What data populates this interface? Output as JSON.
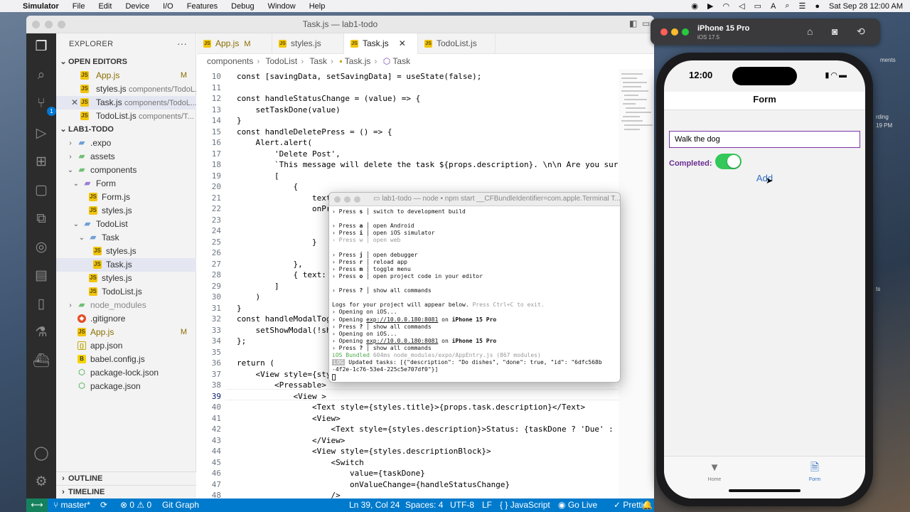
{
  "menubar": {
    "app": "Simulator",
    "items": [
      "File",
      "Edit",
      "Device",
      "I/O",
      "Features",
      "Debug",
      "Window",
      "Help"
    ],
    "datetime": "Sat Sep 28  12:00 AM"
  },
  "vscode": {
    "window_title": "Task.js — lab1-todo",
    "explorer_title": "EXPLORER",
    "open_editors_title": "OPEN EDITORS",
    "open_editors": [
      {
        "name": "App.js",
        "path": "",
        "mark": "M"
      },
      {
        "name": "styles.js",
        "path": "components/TodoL...",
        "mark": ""
      },
      {
        "name": "Task.js",
        "path": "components/TodoL...",
        "mark": ""
      },
      {
        "name": "TodoList.js",
        "path": "components/T...",
        "mark": ""
      }
    ],
    "project_title": "LAB1-TODO",
    "tree": [
      {
        "name": ".expo",
        "mark": ""
      },
      {
        "name": "assets",
        "mark": ""
      },
      {
        "name": "components",
        "mark": ""
      },
      {
        "name": "Form",
        "mark": ""
      },
      {
        "name": "Form.js",
        "mark": ""
      },
      {
        "name": "styles.js",
        "mark": ""
      },
      {
        "name": "TodoList",
        "mark": ""
      },
      {
        "name": "Task",
        "mark": ""
      },
      {
        "name": "styles.js",
        "mark": ""
      },
      {
        "name": "Task.js",
        "mark": ""
      },
      {
        "name": "styles.js",
        "mark": ""
      },
      {
        "name": "TodoList.js",
        "mark": ""
      },
      {
        "name": "node_modules",
        "mark": ""
      },
      {
        "name": ".gitignore",
        "mark": ""
      },
      {
        "name": "App.js",
        "mark": "M"
      },
      {
        "name": "app.json",
        "mark": ""
      },
      {
        "name": "babel.config.js",
        "mark": ""
      },
      {
        "name": "package-lock.json",
        "mark": ""
      },
      {
        "name": "package.json",
        "mark": ""
      }
    ],
    "outline_title": "OUTLINE",
    "timeline_title": "TIMELINE",
    "tabs": [
      {
        "label": "App.js",
        "mark": "M"
      },
      {
        "label": "styles.js",
        "mark": ""
      },
      {
        "label": "Task.js",
        "mark": "",
        "close": "✕"
      },
      {
        "label": "TodoList.js",
        "mark": ""
      }
    ],
    "breadcrumb": [
      "components",
      "TodoList",
      "Task",
      "Task.js",
      "Task"
    ],
    "code_lines": [
      {
        "n": "10",
        "t": "const [savingData, setSavingData] = useState(false);"
      },
      {
        "n": "11",
        "t": ""
      },
      {
        "n": "12",
        "t": "const handleStatusChange = (value) => {"
      },
      {
        "n": "13",
        "t": "    setTaskDone(value)"
      },
      {
        "n": "14",
        "t": "}"
      },
      {
        "n": "15",
        "t": "const handleDeletePress = () => {"
      },
      {
        "n": "16",
        "t": "    Alert.alert("
      },
      {
        "n": "17",
        "t": "        'Delete Post',"
      },
      {
        "n": "18",
        "t": "        `This message will delete the task ${props.description}. \\n\\n Are you sure?`,"
      },
      {
        "n": "19",
        "t": "        ["
      },
      {
        "n": "20",
        "t": "            {"
      },
      {
        "n": "21",
        "t": "                text:"
      },
      {
        "n": "22",
        "t": "                onPre"
      },
      {
        "n": "23",
        "t": "                    c"
      },
      {
        "n": "24",
        "t": "                    h"
      },
      {
        "n": "25",
        "t": "                }"
      },
      {
        "n": "26",
        "t": ""
      },
      {
        "n": "27",
        "t": "            },"
      },
      {
        "n": "28",
        "t": "            { text: '"
      },
      {
        "n": "29",
        "t": "        ]"
      },
      {
        "n": "30",
        "t": "    )"
      },
      {
        "n": "31",
        "t": "}"
      },
      {
        "n": "32",
        "t": "const handleModalTogg"
      },
      {
        "n": "33",
        "t": "    setShowModal(!sho"
      },
      {
        "n": "34",
        "t": "};"
      },
      {
        "n": "35",
        "t": ""
      },
      {
        "n": "36",
        "t": "return ("
      },
      {
        "n": "37",
        "t": "    <View style={styl"
      },
      {
        "n": "38",
        "t": "        <Pressable>"
      },
      {
        "n": "39",
        "t": "            <View >"
      },
      {
        "n": "40",
        "t": "                <Text style={styles.title}>{props.task.description}</Text>"
      },
      {
        "n": "41",
        "t": "                <View>"
      },
      {
        "n": "42",
        "t": "                    <Text style={styles.description}>Status: {taskDone ? 'Due' : 'Done'}"
      },
      {
        "n": "43",
        "t": "                </View>"
      },
      {
        "n": "44",
        "t": "                <View style={styles.descriptionBlock}>"
      },
      {
        "n": "45",
        "t": "                    <Switch"
      },
      {
        "n": "46",
        "t": "                        value={taskDone}"
      },
      {
        "n": "47",
        "t": "                        onValueChange={handleStatusChange}"
      },
      {
        "n": "48",
        "t": "                    />"
      }
    ],
    "status": {
      "branch": "master*",
      "sync": "⟳",
      "problems": "⊗ 0 ⚠ 0",
      "git_graph": "Git Graph",
      "position": "Ln 39, Col 24",
      "spaces": "Spaces: 4",
      "encoding": "UTF-8",
      "eol": "LF",
      "language": "JavaScript",
      "golive": "Go Live",
      "prettier": "Prettier"
    }
  },
  "terminal": {
    "title": "lab1-todo — node • npm start __CFBundleIdentifier=com.apple.Terminal T...",
    "lines": [
      {
        "type": "cmd",
        "key": "s",
        "text": "switch to development build"
      },
      {
        "type": "blank"
      },
      {
        "type": "cmd",
        "key": "a",
        "text": "open Android"
      },
      {
        "type": "cmd",
        "key": "i",
        "text": "open iOS simulator"
      },
      {
        "type": "dimcmd",
        "key": "w",
        "text": "open web"
      },
      {
        "type": "blank"
      },
      {
        "type": "cmd",
        "key": "j",
        "text": "open debugger"
      },
      {
        "type": "cmd",
        "key": "r",
        "text": "reload app"
      },
      {
        "type": "cmd",
        "key": "m",
        "text": "toggle menu"
      },
      {
        "type": "cmd",
        "key": "o",
        "text": "open project code in your editor"
      },
      {
        "type": "blank"
      },
      {
        "type": "cmd",
        "key": "?",
        "text": "show all commands"
      },
      {
        "type": "blank"
      },
      {
        "type": "plain",
        "text": "Logs for your project will appear below.",
        "dim": "Press Ctrl+C to exit."
      },
      {
        "type": "plain",
        "text": "› Opening on iOS..."
      },
      {
        "type": "open",
        "url": "exp://10.0.0.180:8081",
        "dev": "iPhone 15 Pro"
      },
      {
        "type": "cmd",
        "key": "?",
        "text": "show all commands"
      },
      {
        "type": "plain",
        "text": "› Opening on iOS..."
      },
      {
        "type": "open",
        "url": "exp://10.0.0.180:8081",
        "dev": "iPhone 15 Pro"
      },
      {
        "type": "cmd",
        "key": "?",
        "text": "show all commands"
      },
      {
        "type": "bundle",
        "text": "iOS Bundled",
        "rest": "604ms node_modules/expo/AppEntry.js (867 modules)"
      },
      {
        "type": "log",
        "tag": "LOG",
        "text": "Updated tasks: [{\"description\": \"Do dishes\", \"done\": true, \"id\": \"6dfc568b"
      },
      {
        "type": "plain",
        "text": "-4f2e-1c76-53e4-225c5e707df0\"}]"
      }
    ],
    "press_word": "Press",
    "opening_word": "› Opening",
    "on_word": "on"
  },
  "simulator": {
    "device": "iPhone 15 Pro",
    "os": "iOS 17.5",
    "phone": {
      "time": "12:00",
      "nav_title": "Form",
      "input_value": "Walk the dog",
      "completed_label": "Completed:",
      "toggle_on": true,
      "add_label": "Add",
      "tabs": [
        {
          "label": "Home",
          "icon": "▼"
        },
        {
          "label": "Form",
          "icon": "🗎"
        }
      ],
      "accent": "#2f6fc1",
      "switch_color": "#34c759"
    }
  },
  "desktop_labels": [
    "ments",
    "rding",
    "19 PM",
    "ts"
  ]
}
